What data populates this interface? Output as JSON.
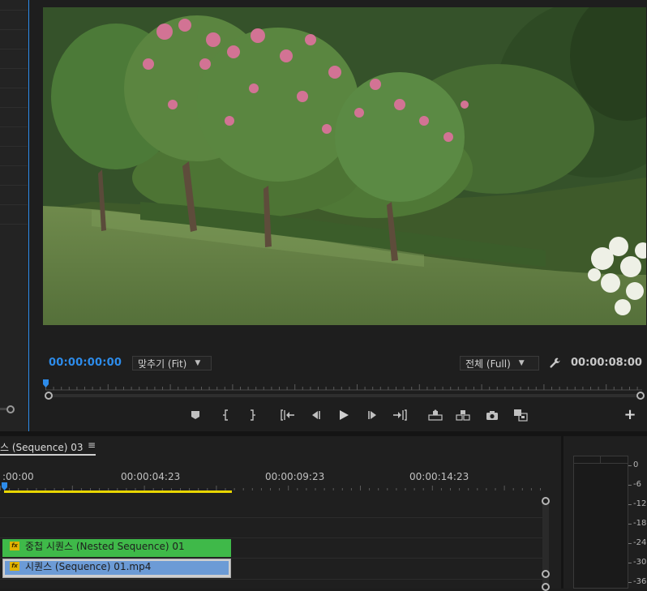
{
  "program_monitor": {
    "timecode_current": "00:00:00:00",
    "zoom_label": "맞추기 (Fit)",
    "resolution_label": "전체 (Full)",
    "timecode_duration": "00:00:08:00",
    "accent_color": "#2d8ceb"
  },
  "transport_icons": [
    "add-marker-icon",
    "mark-in-icon",
    "mark-out-icon",
    "go-to-in-icon",
    "step-back-icon",
    "play-icon",
    "step-forward-icon",
    "go-to-out-icon",
    "lift-icon",
    "extract-icon",
    "export-frame-icon",
    "comparison-view-icon"
  ],
  "add_button_icon": "plus-icon",
  "timeline": {
    "tab_label": "스 (Sequence) 03",
    "tab_menu_glyph": "≡",
    "ruler_timecodes": [
      ":00:00",
      "00:00:04:23",
      "00:00:09:23",
      "00:00:14:23"
    ],
    "clips": [
      {
        "name": "중첩 시퀀스 (Nested Sequence) 01",
        "color": "#3fb949",
        "fx": "fx"
      },
      {
        "name": "시퀀스 (Sequence) 01.mp4",
        "color": "#6c9bd6",
        "fx": "fx"
      }
    ]
  },
  "audio_meter": {
    "scale": [
      "0",
      "-6",
      "-12",
      "-18",
      "-24",
      "-30",
      "-36"
    ]
  }
}
